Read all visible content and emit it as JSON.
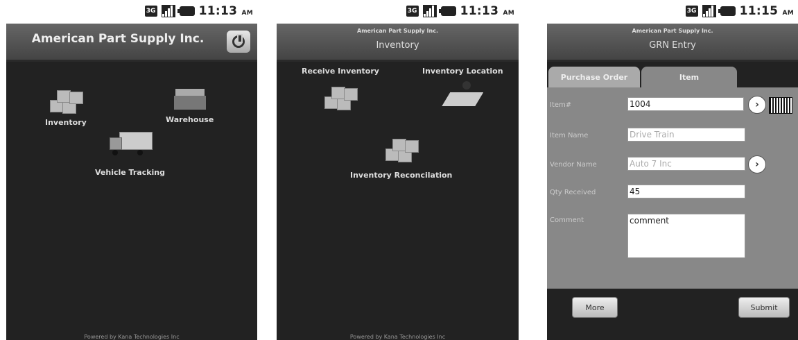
{
  "status": {
    "time": "11:13",
    "time3": "11:15",
    "ampm": "AM",
    "network": "3G"
  },
  "screen1": {
    "title": "American Part Supply Inc.",
    "tiles": [
      {
        "label": "Inventory",
        "icon": "boxes-icon"
      },
      {
        "label": "Warehouse",
        "icon": "warehouse-icon"
      },
      {
        "label": "Vehicle Tracking",
        "icon": "truck-icon"
      }
    ],
    "footer": "Powered by Kana Technologies Inc"
  },
  "screen2": {
    "company": "American Part Supply Inc.",
    "title": "Inventory",
    "tiles": [
      {
        "label": "Receive Inventory",
        "icon": "receive-boxes-icon"
      },
      {
        "label": "Inventory Location",
        "icon": "map-pin-icon"
      },
      {
        "label": "Inventory Reconcilation",
        "icon": "reconcile-boxes-icon"
      }
    ],
    "footer": "Powered by Kana Technologies Inc"
  },
  "screen3": {
    "company": "American Part Supply Inc.",
    "title": "GRN Entry",
    "tabs": [
      "Purchase Order",
      "Item"
    ],
    "fields": {
      "item_label": "Item#",
      "item_value": "1004",
      "name_label": "Item Name",
      "name_value": "Drive Train",
      "vendor_label": "Vendor Name",
      "vendor_value": "Auto 7 Inc",
      "qty_label": "Qty Received",
      "qty_value": "45",
      "comment_label": "Comment",
      "comment_value": "comment"
    },
    "more_label": "More",
    "submit_label": "Submit"
  }
}
